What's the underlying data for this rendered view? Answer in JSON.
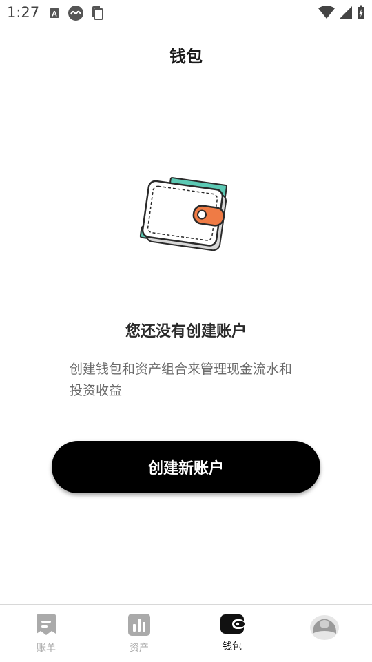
{
  "status_bar": {
    "time": "1:27",
    "left_icons": [
      "a-notification-icon",
      "link-notification-icon",
      "copy-notification-icon"
    ],
    "right_icons": [
      "wifi-icon",
      "cell-signal-icon",
      "battery-charging-icon"
    ]
  },
  "header": {
    "title": "钱包"
  },
  "empty_state": {
    "illustration": "wallet-icon",
    "title": "您还没有创建账户",
    "description_line1": "创建钱包和资产组合来管理现金流水和",
    "description_line2": "投资收益",
    "button_label": "创建新账户"
  },
  "bottom_nav": {
    "items": [
      {
        "label": "账单",
        "icon": "bill-icon",
        "active": false
      },
      {
        "label": "资产",
        "icon": "bar-chart-icon",
        "active": false
      },
      {
        "label": "钱包",
        "icon": "wallet-icon",
        "active": true
      },
      {
        "label": "",
        "icon": "profile-icon",
        "active": false
      }
    ]
  },
  "colors": {
    "accent": "#000000",
    "inactive": "#aaaaaa",
    "wallet_teal": "#5cc9b4",
    "wallet_orange": "#ef7b45"
  }
}
